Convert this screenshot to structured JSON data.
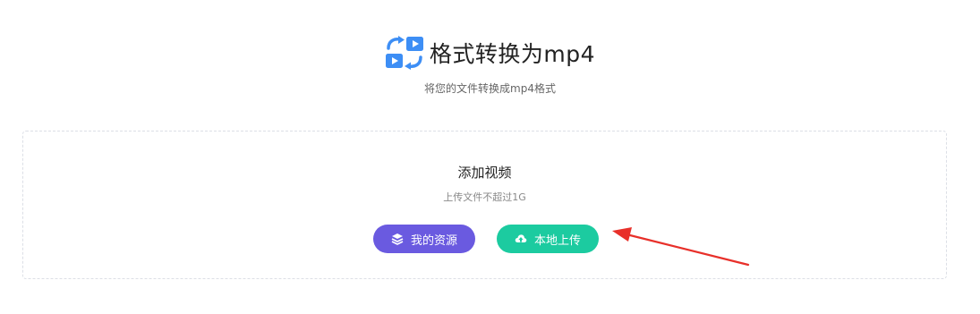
{
  "header": {
    "title": "格式转换为mp4",
    "subtitle": "将您的文件转换成mp4格式",
    "icon": "video-convert-icon"
  },
  "dropzone": {
    "title": "添加视频",
    "size_note": "上传文件不超过1G"
  },
  "buttons": {
    "my_resources_label": "我的资源",
    "my_resources_icon": "layers-icon",
    "local_upload_label": "本地上传",
    "local_upload_icon": "cloud-upload-icon"
  },
  "colors": {
    "icon_blue": "#3d8ef5",
    "resources_button": "#6a5ae0",
    "upload_button": "#1ccba0",
    "annotation_arrow": "#e8302a"
  }
}
